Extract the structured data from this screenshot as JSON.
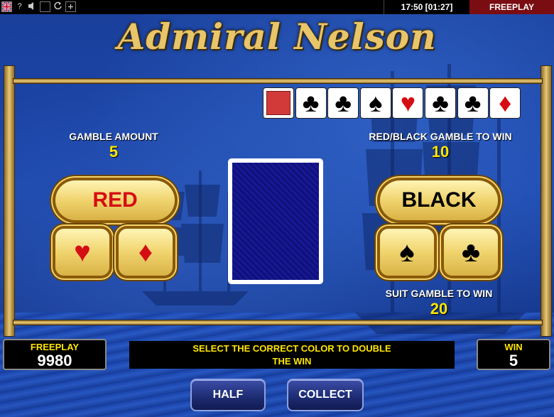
{
  "topbar": {
    "help_label": "?",
    "time": "17:50 [01:27]",
    "mode": "FREEPLAY"
  },
  "game": {
    "title": "Admiral Nelson"
  },
  "history": [
    {
      "type": "back"
    },
    {
      "suit": "♣",
      "color": "black"
    },
    {
      "suit": "♣",
      "color": "black"
    },
    {
      "suit": "♠",
      "color": "black"
    },
    {
      "suit": "♥",
      "color": "red"
    },
    {
      "suit": "♣",
      "color": "black"
    },
    {
      "suit": "♣",
      "color": "black"
    },
    {
      "suit": "♦",
      "color": "red"
    }
  ],
  "gamble": {
    "amount_label": "GAMBLE AMOUNT",
    "amount": "5",
    "color_win_label": "RED/BLACK GAMBLE TO WIN",
    "color_win": "10",
    "suit_win_label": "SUIT GAMBLE TO WIN",
    "suit_win": "20"
  },
  "buttons": {
    "red": "RED",
    "black": "BLACK",
    "hearts": "♥",
    "diamonds": "♦",
    "spades": "♠",
    "clubs": "♣",
    "half": "HALF",
    "collect": "COLLECT"
  },
  "bottom": {
    "credit_label": "FREEPLAY",
    "credit": "9980",
    "message_line1": "SELECT THE CORRECT COLOR TO DOUBLE",
    "message_line2": "THE WIN",
    "win_label": "WIN",
    "win": "5"
  },
  "colors": {
    "gold": "#f0d46e",
    "red_suit": "#d50e14",
    "yellow_text": "#ffe600",
    "freeplay_bg": "#7a0d12"
  }
}
